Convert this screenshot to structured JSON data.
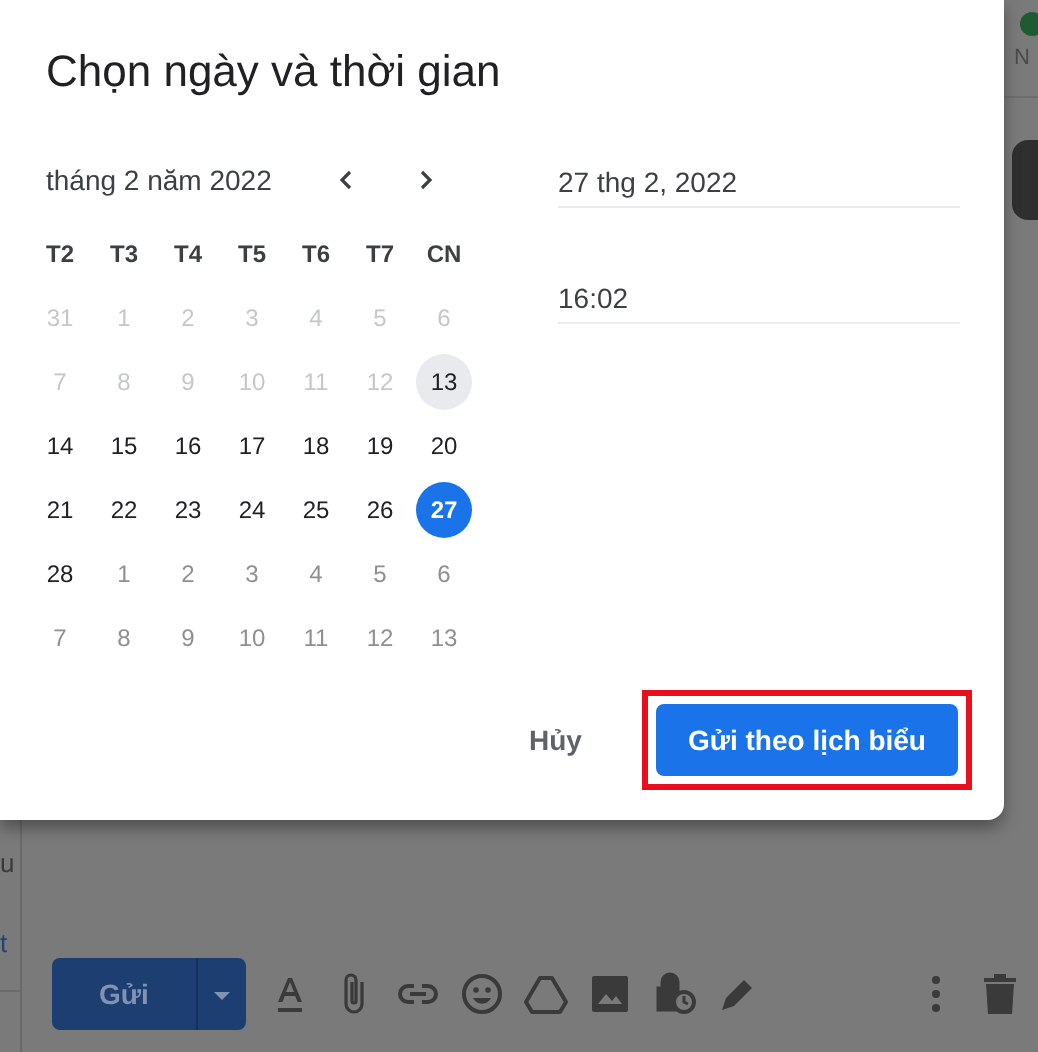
{
  "background": {
    "contact_label": "N",
    "snippet_1": "u",
    "snippet_2": "t"
  },
  "compose_toolbar": {
    "send_button": "Gửi"
  },
  "dialog": {
    "title": "Chọn ngày và thời gian",
    "calendar": {
      "month_label": "tháng 2 năm 2022",
      "weekdays": [
        "T2",
        "T3",
        "T4",
        "T5",
        "T6",
        "T7",
        "CN"
      ],
      "weeks": [
        [
          {
            "label": "31",
            "kind": "past",
            "selected": false
          },
          {
            "label": "1",
            "kind": "past",
            "selected": false
          },
          {
            "label": "2",
            "kind": "past",
            "selected": false
          },
          {
            "label": "3",
            "kind": "past",
            "selected": false
          },
          {
            "label": "4",
            "kind": "past",
            "selected": false
          },
          {
            "label": "5",
            "kind": "past",
            "selected": false
          },
          {
            "label": "6",
            "kind": "past",
            "selected": false
          }
        ],
        [
          {
            "label": "7",
            "kind": "past",
            "selected": false
          },
          {
            "label": "8",
            "kind": "past",
            "selected": false
          },
          {
            "label": "9",
            "kind": "past",
            "selected": false
          },
          {
            "label": "10",
            "kind": "past",
            "selected": false
          },
          {
            "label": "11",
            "kind": "past",
            "selected": false
          },
          {
            "label": "12",
            "kind": "past",
            "selected": false
          },
          {
            "label": "13",
            "kind": "today",
            "selected": false
          }
        ],
        [
          {
            "label": "14",
            "kind": "current",
            "selected": false
          },
          {
            "label": "15",
            "kind": "current",
            "selected": false
          },
          {
            "label": "16",
            "kind": "current",
            "selected": false
          },
          {
            "label": "17",
            "kind": "current",
            "selected": false
          },
          {
            "label": "18",
            "kind": "current",
            "selected": false
          },
          {
            "label": "19",
            "kind": "current",
            "selected": false
          },
          {
            "label": "20",
            "kind": "current",
            "selected": false
          }
        ],
        [
          {
            "label": "21",
            "kind": "current",
            "selected": false
          },
          {
            "label": "22",
            "kind": "current",
            "selected": false
          },
          {
            "label": "23",
            "kind": "current",
            "selected": false
          },
          {
            "label": "24",
            "kind": "current",
            "selected": false
          },
          {
            "label": "25",
            "kind": "current",
            "selected": false
          },
          {
            "label": "26",
            "kind": "current",
            "selected": false
          },
          {
            "label": "27",
            "kind": "current",
            "selected": true
          }
        ],
        [
          {
            "label": "28",
            "kind": "current",
            "selected": false
          },
          {
            "label": "1",
            "kind": "next_month",
            "selected": false
          },
          {
            "label": "2",
            "kind": "next_month",
            "selected": false
          },
          {
            "label": "3",
            "kind": "next_month",
            "selected": false
          },
          {
            "label": "4",
            "kind": "next_month",
            "selected": false
          },
          {
            "label": "5",
            "kind": "next_month",
            "selected": false
          },
          {
            "label": "6",
            "kind": "next_month",
            "selected": false
          }
        ],
        [
          {
            "label": "7",
            "kind": "next_month",
            "selected": false
          },
          {
            "label": "8",
            "kind": "next_month",
            "selected": false
          },
          {
            "label": "9",
            "kind": "next_month",
            "selected": false
          },
          {
            "label": "10",
            "kind": "next_month",
            "selected": false
          },
          {
            "label": "11",
            "kind": "next_month",
            "selected": false
          },
          {
            "label": "12",
            "kind": "next_month",
            "selected": false
          },
          {
            "label": "13",
            "kind": "next_month",
            "selected": false
          }
        ]
      ]
    },
    "date_field": {
      "value": "27 thg 2, 2022"
    },
    "time_field": {
      "value": "16:02"
    },
    "cancel_button": "Hủy",
    "schedule_button": {
      "label": "Gửi theo lịch biểu",
      "highlighted": true
    }
  }
}
